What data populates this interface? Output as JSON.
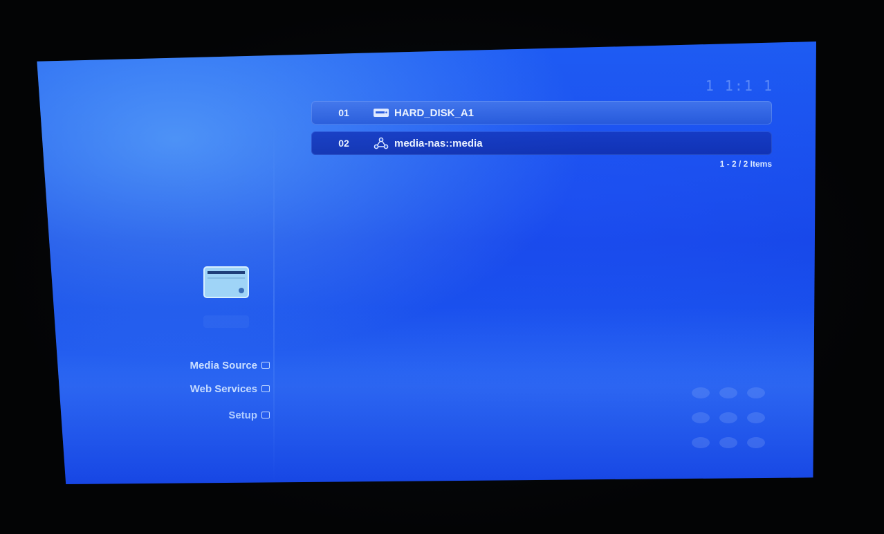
{
  "header": {
    "clock_text": "1 1:1 1"
  },
  "source_list": {
    "items": [
      {
        "number": "01",
        "label": "HARD_DISK_A1",
        "icon": "hard-disk-icon",
        "selected": true
      },
      {
        "number": "02",
        "label": "media-nas::media",
        "icon": "network-share-icon",
        "selected": false
      }
    ],
    "count_text": "1 - 2 / 2 Items"
  },
  "sidebar": {
    "device_icon": "storage-device-icon",
    "menu": [
      {
        "label": "Media Source"
      },
      {
        "label": "Web Services"
      },
      {
        "label": "Setup"
      }
    ]
  },
  "colors": {
    "screen_blue": "#1b58ef",
    "selected_row": "#4678eb",
    "text": "#eaf2ff"
  }
}
